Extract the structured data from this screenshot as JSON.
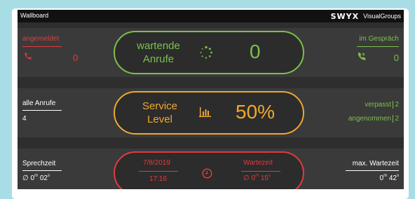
{
  "window": {
    "title": "Wallboard",
    "brand_logo": "SWYX",
    "brand_text": "VisualGroups"
  },
  "row1": {
    "left_label": "angemeldet",
    "left_icon": "phone-icon",
    "left_value": "0",
    "center_label_line1": "wartende",
    "center_label_line2": "Anrufe",
    "center_icon": "spinner-icon",
    "center_value": "0",
    "right_label": "im Gespräch",
    "right_icon": "phone-in-talk-icon",
    "right_value": "0"
  },
  "row2": {
    "left_label": "alle Anrufe",
    "left_value": "4",
    "center_label_line1": "Service",
    "center_label_line2": "Level",
    "center_icon": "bar-chart-icon",
    "center_value": "50%",
    "right_label1": "verpasst",
    "right_value1": "2",
    "right_label2": "angenommen",
    "right_value2": "2"
  },
  "row3": {
    "left_label": "Sprechzeit",
    "left_value_prefix": "∅ 0",
    "left_value_unit1": "m",
    "left_value_mid": " 02",
    "left_value_unit2": "s",
    "date": "7/8/2019",
    "time": "17:16",
    "center_icon": "clock-icon",
    "wait_label": "Wartezeit",
    "wait_prefix": "∅ 0",
    "wait_unit1": "m",
    "wait_mid": " 15",
    "wait_unit2": "s",
    "right_label": "max. Wartezeit",
    "right_prefix": "0",
    "right_unit1": "m",
    "right_mid": " 42",
    "right_unit2": "s"
  },
  "colors": {
    "green": "#7cc04a",
    "orange": "#f0a830",
    "red": "#e03c3c",
    "panel": "#3a3a3a"
  }
}
